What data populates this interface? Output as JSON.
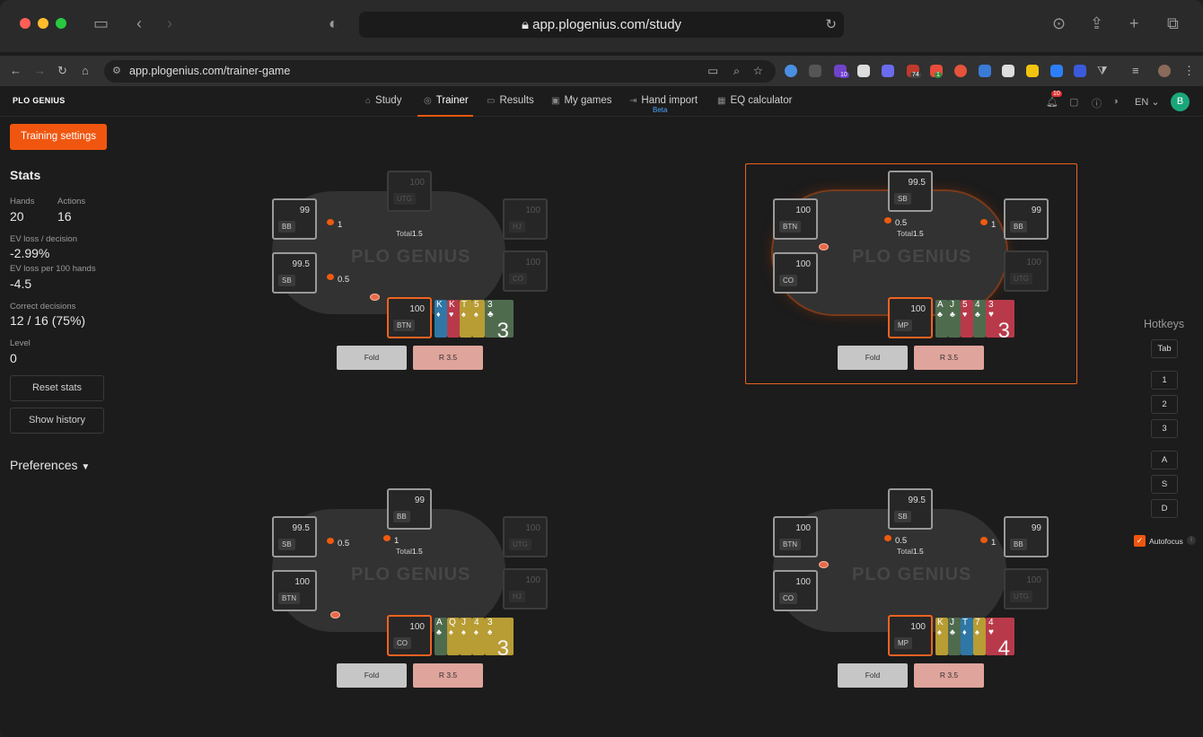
{
  "safari": {
    "url": "app.plogenius.com/study"
  },
  "chrome": {
    "url": "app.plogenius.com/trainer-game",
    "badges": [
      "10",
      "74",
      "1"
    ]
  },
  "nav": {
    "logo": "PLO GENIUS",
    "items": [
      {
        "label": "Study",
        "icon": "book-icon"
      },
      {
        "label": "Trainer",
        "icon": "gamepad-icon"
      },
      {
        "label": "Results",
        "icon": "chart-icon"
      },
      {
        "label": "My games",
        "icon": "cards-icon"
      },
      {
        "label": "Hand import",
        "icon": "import-icon"
      },
      {
        "label": "EQ calculator",
        "icon": "calculator-icon"
      }
    ],
    "beta": "Beta",
    "notif_count": "10",
    "lang": "EN",
    "avatar": "B"
  },
  "sidebar": {
    "training_settings": "Training settings",
    "stats_title": "Stats",
    "hands_label": "Hands",
    "hands": "20",
    "actions_label": "Actions",
    "actions": "16",
    "ev_loss_label": "EV loss / decision",
    "ev_loss": "-2.99%",
    "ev_100_label": "EV loss per 100 hands",
    "ev_100": "-4.5",
    "correct_label": "Correct decisions",
    "correct": "12 / 16 (75%)",
    "level_label": "Level",
    "level": "0",
    "reset": "Reset stats",
    "history": "Show history",
    "preferences": "Preferences"
  },
  "tables": [
    {
      "total_label": "Total",
      "total": "1.5",
      "fold": "Fold",
      "raise": "R 3.5",
      "seats": {
        "top": {
          "stack": "100",
          "pos": "UTG"
        },
        "tr": {
          "stack": "100",
          "pos": "HJ"
        },
        "r": {
          "stack": "100",
          "pos": "CO"
        },
        "tl": {
          "stack": "99",
          "pos": "BB"
        },
        "l": {
          "stack": "99.5",
          "pos": "SB"
        },
        "hero": {
          "stack": "100",
          "pos": "BTN"
        }
      },
      "bets": [
        "1",
        "0.5"
      ],
      "cards": [
        {
          "r": "K",
          "s": "♦",
          "c": "cd"
        },
        {
          "r": "K",
          "s": "♥",
          "c": "ch"
        },
        {
          "r": "T",
          "s": "♠",
          "c": "cy"
        },
        {
          "r": "5",
          "s": "♠",
          "c": "cy"
        }
      ],
      "last": {
        "r": "3",
        "s": "♣",
        "n": "3",
        "c": "cs"
      }
    },
    {
      "total_label": "Total",
      "total": "1.5",
      "fold": "Fold",
      "raise": "R 3.5",
      "seats": {
        "top": {
          "stack": "99.5",
          "pos": "SB"
        },
        "tr": {
          "stack": "99",
          "pos": "BB"
        },
        "r": {
          "stack": "100",
          "pos": "UTG"
        },
        "tl": {
          "stack": "100",
          "pos": "BTN"
        },
        "l": {
          "stack": "100",
          "pos": "CO"
        },
        "hero": {
          "stack": "100",
          "pos": "MP"
        }
      },
      "bets": [
        "0.5",
        "1"
      ],
      "cards": [
        {
          "r": "A",
          "s": "♣",
          "c": "cs"
        },
        {
          "r": "J",
          "s": "♣",
          "c": "cs"
        },
        {
          "r": "5",
          "s": "♥",
          "c": "ch"
        },
        {
          "r": "4",
          "s": "♣",
          "c": "cs"
        }
      ],
      "last": {
        "r": "3",
        "s": "♥",
        "n": "3",
        "c": "ch"
      }
    },
    {
      "total_label": "Total",
      "total": "1.5",
      "fold": "Fold",
      "raise": "R 3.5",
      "seats": {
        "top": {
          "stack": "99",
          "pos": "BB"
        },
        "tr": {
          "stack": "100",
          "pos": "UTG"
        },
        "r": {
          "stack": "100",
          "pos": "HJ"
        },
        "tl": {
          "stack": "99.5",
          "pos": "SB"
        },
        "l": {
          "stack": "100",
          "pos": "BTN"
        },
        "hero": {
          "stack": "100",
          "pos": "CO"
        }
      },
      "bets": [
        "0.5",
        "1"
      ],
      "cards": [
        {
          "r": "A",
          "s": "♣",
          "c": "cs"
        },
        {
          "r": "Q",
          "s": "♠",
          "c": "cy"
        },
        {
          "r": "J",
          "s": "♠",
          "c": "cy"
        },
        {
          "r": "4",
          "s": "♠",
          "c": "cy"
        }
      ],
      "last": {
        "r": "3",
        "s": "♠",
        "n": "3",
        "c": "cy"
      }
    },
    {
      "total_label": "Total",
      "total": "1.5",
      "fold": "Fold",
      "raise": "R 3.5",
      "seats": {
        "top": {
          "stack": "99.5",
          "pos": "SB"
        },
        "tr": {
          "stack": "99",
          "pos": "BB"
        },
        "r": {
          "stack": "100",
          "pos": "UTG"
        },
        "tl": {
          "stack": "100",
          "pos": "BTN"
        },
        "l": {
          "stack": "100",
          "pos": "CO"
        },
        "hero": {
          "stack": "100",
          "pos": "MP"
        }
      },
      "bets": [
        "0.5",
        "1"
      ],
      "cards": [
        {
          "r": "K",
          "s": "♠",
          "c": "cy"
        },
        {
          "r": "J",
          "s": "♣",
          "c": "cs"
        },
        {
          "r": "T",
          "s": "♦",
          "c": "cd"
        },
        {
          "r": "7",
          "s": "♠",
          "c": "cy"
        }
      ],
      "last": {
        "r": "4",
        "s": "♥",
        "n": "4",
        "c": "ch"
      }
    }
  ],
  "hotkeys": {
    "title": "Hotkeys",
    "keys": [
      "Tab",
      "1",
      "2",
      "3",
      "A",
      "S",
      "D"
    ],
    "autofocus": "Autofocus",
    "autofocus_check": "✓"
  }
}
